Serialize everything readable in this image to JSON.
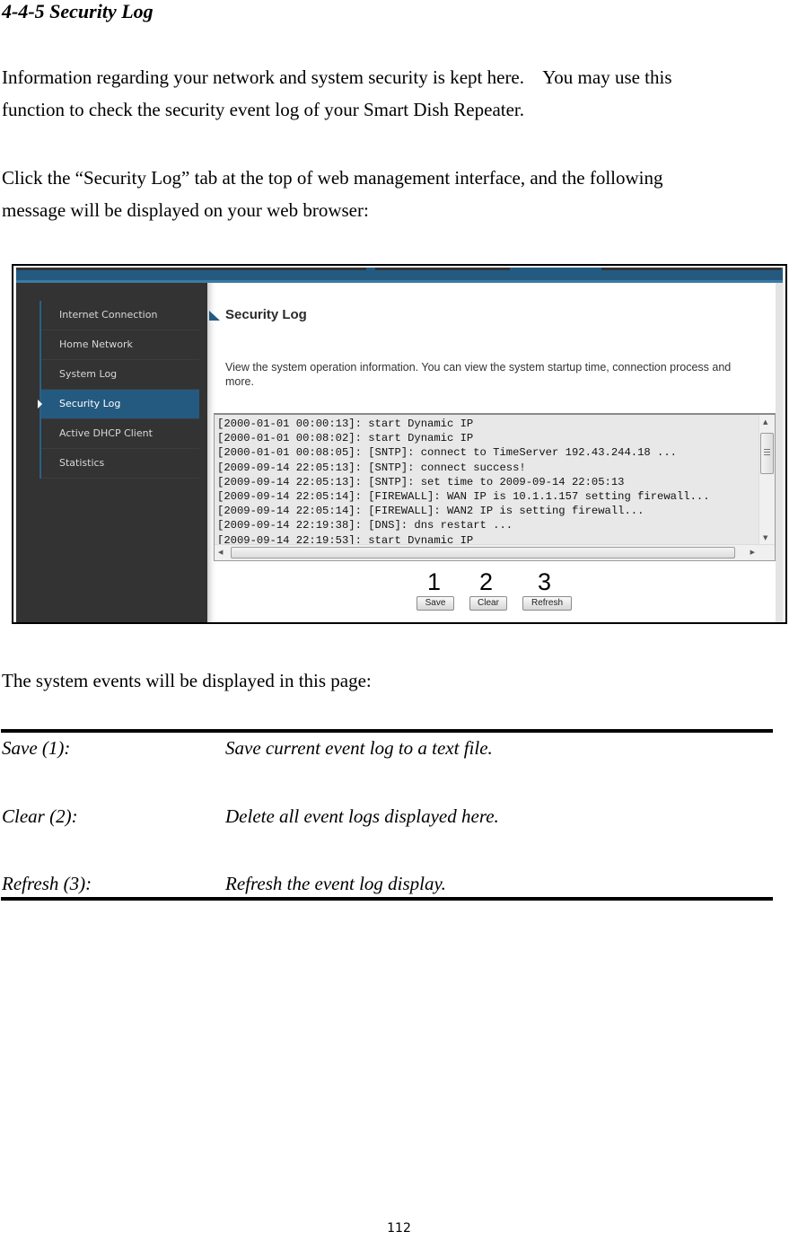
{
  "document": {
    "section_title": "4-4-5 Security Log",
    "intro_line1": "Information regarding your network and system security is kept here.    You may use this",
    "intro_line2": "function to check the security event log of your Smart Dish Repeater.",
    "click_line1": "Click the “Security Log” tab at the top of web management interface, and the following",
    "click_line2": "message will be displayed on your web browser:",
    "events_intro": "The system events will be displayed in this page:",
    "page_number": "112"
  },
  "screenshot": {
    "sidebar": {
      "items": [
        {
          "label": "Internet Connection",
          "active": false
        },
        {
          "label": "Home Network",
          "active": false
        },
        {
          "label": "System Log",
          "active": false
        },
        {
          "label": "Security Log",
          "active": true
        },
        {
          "label": "Active DHCP Client",
          "active": false
        },
        {
          "label": "Statistics",
          "active": false
        }
      ]
    },
    "heading": "Security Log",
    "description": "View the system operation information. You can view the system startup time, connection process and more.",
    "log_lines": [
      "[2000-01-01 00:00:13]: start Dynamic IP",
      "[2000-01-01 00:08:02]: start Dynamic IP",
      "[2000-01-01 00:08:05]: [SNTP]: connect to TimeServer 192.43.244.18 ...",
      "[2009-09-14 22:05:13]: [SNTP]: connect success!",
      "[2009-09-14 22:05:13]: [SNTP]: set time to 2009-09-14 22:05:13",
      "[2009-09-14 22:05:14]: [FIREWALL]: WAN IP is 10.1.1.157 setting firewall...",
      "[2009-09-14 22:05:14]: [FIREWALL]: WAN2 IP is setting firewall...",
      "[2009-09-14 22:19:38]: [DNS]: dns restart ...",
      "[2009-09-14 22:19:53]: start Dynamic IP"
    ],
    "buttons": {
      "save": "Save",
      "clear": "Clear",
      "refresh": "Refresh"
    },
    "callouts": {
      "save": "1",
      "clear": "2",
      "refresh": "3"
    },
    "colors": {
      "accent_blue": "#245a80",
      "sidebar_bg": "#333333"
    }
  },
  "definitions": [
    {
      "label": "Save (1):",
      "description": "Save current event log to a text file."
    },
    {
      "label": "Clear (2):",
      "description": "Delete all event logs displayed here."
    },
    {
      "label": "Refresh (3):",
      "description": "Refresh the event log display."
    }
  ]
}
